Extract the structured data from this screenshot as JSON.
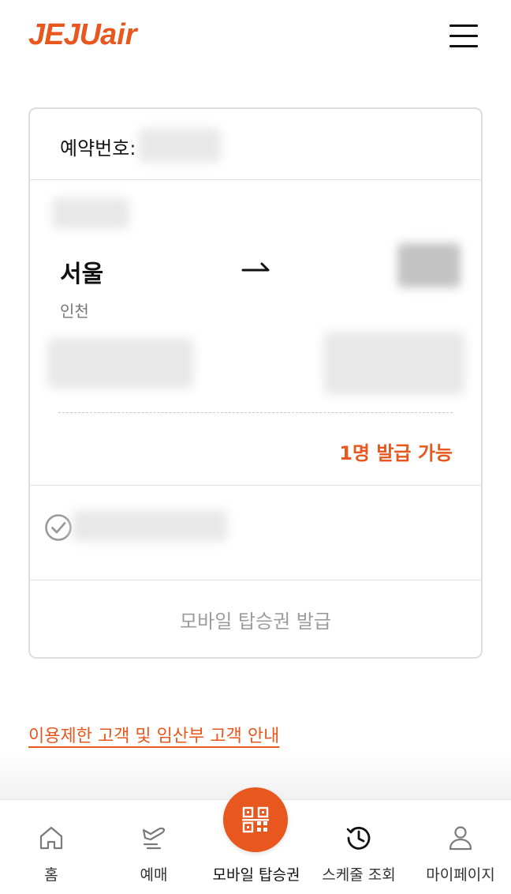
{
  "header": {
    "logo_main": "JEJU",
    "logo_suffix": "air",
    "menu_icon": "hamburger-menu-icon"
  },
  "card": {
    "booking_label": "예약번호:",
    "departure": {
      "city": "서울",
      "airport": "인천"
    },
    "arrow_icon": "arrow-right-icon",
    "availability": "1명 발급 가능",
    "check_icon": "check-circle-icon",
    "issue_button": "모바일 탑승권 발급"
  },
  "notice_link": "이용제한 고객 및 임산부 고객 안내",
  "bottom_nav": {
    "items": [
      {
        "label": "홈",
        "icon": "home-icon"
      },
      {
        "label": "예매",
        "icon": "plane-ticket-icon"
      },
      {
        "label": "모바일 탑승권",
        "icon": "qr-code-icon"
      },
      {
        "label": "스케줄 조회",
        "icon": "clock-history-icon"
      },
      {
        "label": "마이페이지",
        "icon": "user-icon"
      }
    ]
  },
  "colors": {
    "brand": "#e8571e",
    "muted_text": "#9c9c9c",
    "border": "#dedede"
  }
}
